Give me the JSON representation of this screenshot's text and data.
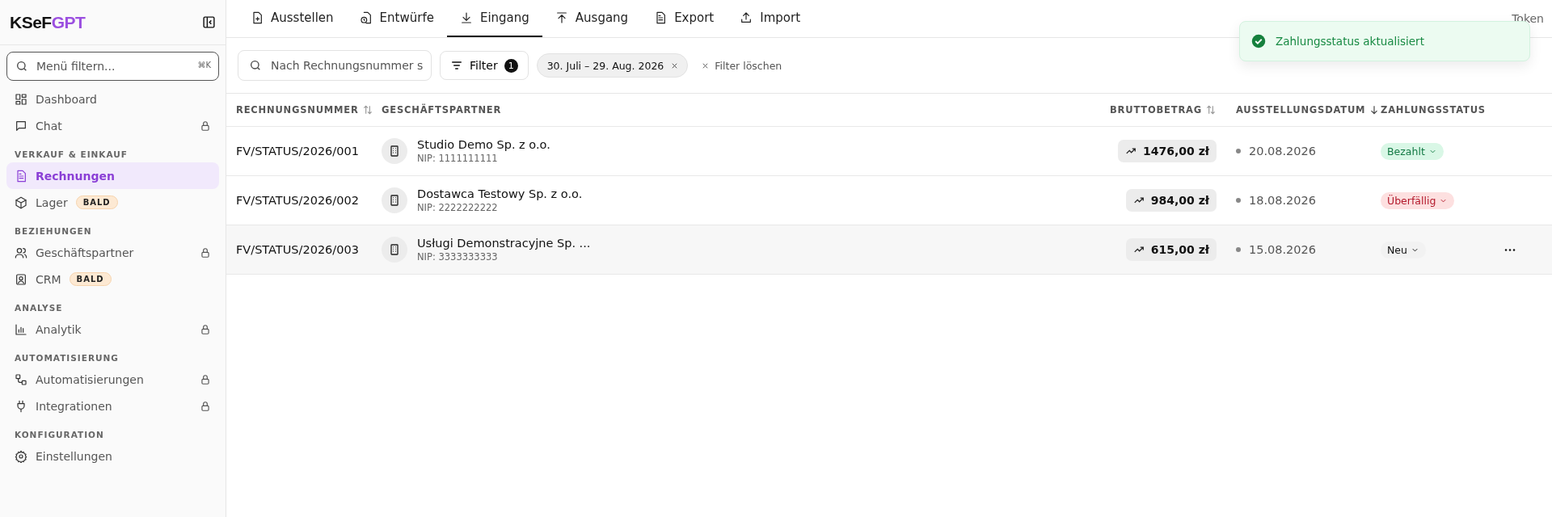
{
  "sidebar": {
    "logo": {
      "part_1": "KSeF",
      "part_2": "GPT"
    },
    "search": {
      "placeholder": "Menü filtern...",
      "shortcut": "⌘K"
    },
    "groups": [
      {
        "items": [
          {
            "label": "Dashboard",
            "selected": false,
            "locked": false
          },
          {
            "label": "Chat",
            "selected": false,
            "locked": true
          }
        ]
      },
      {
        "title": "VERKAUF & EINKAUF",
        "items": [
          {
            "label": "Rechnungen",
            "selected": true,
            "locked": false
          },
          {
            "label": "Lager",
            "selected": false,
            "locked": false,
            "badge": "BALD"
          }
        ]
      },
      {
        "title": "BEZIEHUNGEN",
        "items": [
          {
            "label": "Geschäftspartner",
            "selected": false,
            "locked": true
          },
          {
            "label": "CRM",
            "selected": false,
            "locked": false,
            "badge": "BALD"
          }
        ]
      },
      {
        "title": "ANALYSE",
        "items": [
          {
            "label": "Analytik",
            "selected": false,
            "locked": true
          }
        ]
      },
      {
        "title": "AUTOMATISIERUNG",
        "items": [
          {
            "label": "Automatisierungen",
            "selected": false,
            "locked": true
          },
          {
            "label": "Integrationen",
            "selected": false,
            "locked": true
          }
        ]
      },
      {
        "title": "KONFIGURATION",
        "items": [
          {
            "label": "Einstellungen",
            "selected": false,
            "locked": false
          }
        ]
      }
    ]
  },
  "tabs": [
    {
      "label": "Ausstellen",
      "selected": false
    },
    {
      "label": "Entwürfe",
      "selected": false
    },
    {
      "label": "Eingang",
      "selected": true
    },
    {
      "label": "Ausgang",
      "selected": false
    },
    {
      "label": "Export",
      "selected": false
    },
    {
      "label": "Import",
      "selected": false
    }
  ],
  "token_link": "Token",
  "toolbar": {
    "search": {
      "placeholder": "Nach Rechnungsnummer s"
    },
    "filter": {
      "label": "Filter",
      "count": "1"
    },
    "chip": "30. Juli – 29. Aug. 2026",
    "clear": "Filter löschen"
  },
  "table": {
    "columns": [
      {
        "label": "RECHNUNGSNUMMER"
      },
      {
        "label": "GESCHÄFTSPARTNER"
      },
      {
        "label": "BRUTTOBETRAG"
      },
      {
        "label": "AUSSTELLUNGSDATUM"
      },
      {
        "label": "ZAHLUNGSSTATUS"
      }
    ],
    "rows": [
      {
        "number": "FV/STATUS/2026/001",
        "partner": "Studio Demo Sp. z o.o.",
        "nip": "NIP: 1111111111",
        "amount": "1476,00 zł",
        "date": "20.08.2026",
        "status": "Bezahlt",
        "kind": "paid",
        "hovered": false
      },
      {
        "number": "FV/STATUS/2026/002",
        "partner": "Dostawca Testowy Sp. z o.o.",
        "nip": "NIP: 2222222222",
        "amount": "984,00 zł",
        "date": "18.08.2026",
        "status": "Überfällig",
        "kind": "overdue",
        "hovered": false
      },
      {
        "number": "FV/STATUS/2026/003",
        "partner": "Usługi Demonstracyjne Sp. ...",
        "nip": "NIP: 3333333333",
        "amount": "615,00 zł",
        "date": "15.08.2026",
        "status": "Neu",
        "kind": "new",
        "hovered": true
      }
    ]
  },
  "toast": {
    "message": "Zahlungsstatus aktualisiert",
    "kind": "success"
  }
}
